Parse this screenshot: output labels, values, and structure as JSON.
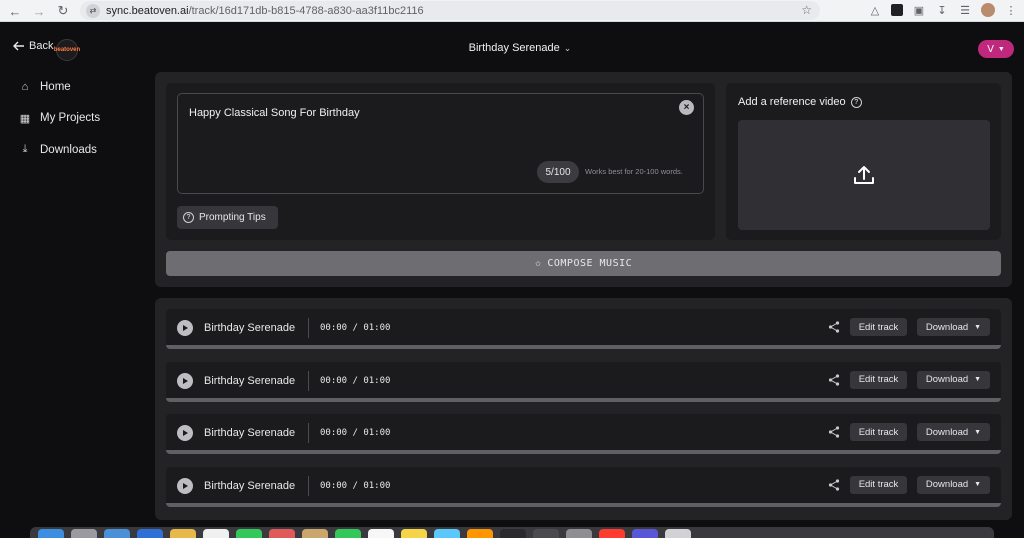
{
  "browser": {
    "url_host": "sync.beatoven.ai",
    "url_path": "/track/16d171db-b815-4788-a830-aa3f11bc2116"
  },
  "header": {
    "back_label": "Back",
    "logo_text": "beatoven",
    "project_title": "Birthday Serenade",
    "user_initial": "V"
  },
  "sidebar": {
    "items": [
      {
        "label": "Home",
        "icon": "home-icon"
      },
      {
        "label": "My Projects",
        "icon": "image-icon"
      },
      {
        "label": "Downloads",
        "icon": "download-icon"
      }
    ]
  },
  "composer": {
    "prompt_value": "Happy Classical Song For Birthday",
    "word_count": "5/100",
    "hint": "Works best for 20-100 words.",
    "tips_label": "Prompting Tips",
    "video_title": "Add a reference video",
    "compose_label": "COMPOSE MUSIC"
  },
  "tracks": [
    {
      "name": "Birthday Serenade",
      "time": "00:00 / 01:00",
      "edit_label": "Edit track",
      "download_label": "Download"
    },
    {
      "name": "Birthday Serenade",
      "time": "00:00 / 01:00",
      "edit_label": "Edit track",
      "download_label": "Download"
    },
    {
      "name": "Birthday Serenade",
      "time": "00:00 / 01:00",
      "edit_label": "Edit track",
      "download_label": "Download"
    },
    {
      "name": "Birthday Serenade",
      "time": "00:00 / 01:00",
      "edit_label": "Edit track",
      "download_label": "Download"
    }
  ],
  "colors": {
    "accent": "#c0287d",
    "panel": "#232326",
    "card": "#1b1b1e"
  }
}
